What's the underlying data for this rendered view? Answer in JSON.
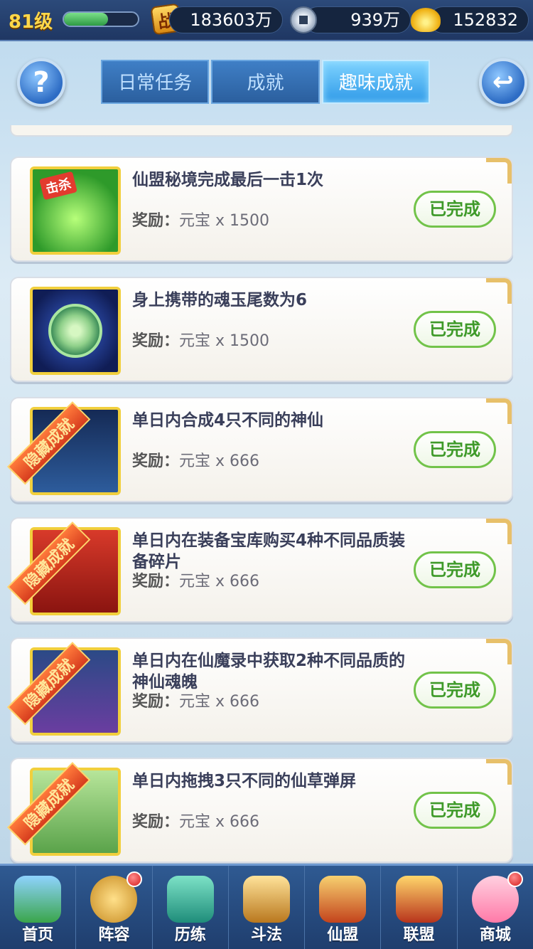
{
  "status": {
    "level": "81级",
    "level_progress": 0.6,
    "battle_power": "183603万",
    "silver": "939万",
    "gold": "152832"
  },
  "header": {
    "tabs": [
      {
        "label": "日常任务",
        "active": false
      },
      {
        "label": "成就",
        "active": false
      },
      {
        "label": "趣味成就",
        "active": true
      }
    ]
  },
  "achievements": [
    {
      "title": "仙盟秘境完成最后一击1次",
      "reward_label": "奖励：",
      "reward_value": "元宝 x 1500",
      "button": "已完成",
      "hidden_tag": "",
      "thumb_tag": "击杀"
    },
    {
      "title": "身上携带的魂玉尾数为6",
      "reward_label": "奖励：",
      "reward_value": "元宝 x 1500",
      "button": "已完成",
      "hidden_tag": ""
    },
    {
      "title": "单日内合成4只不同的神仙",
      "reward_label": "奖励：",
      "reward_value": "元宝 x 666",
      "button": "已完成",
      "hidden_tag": "隐藏成就"
    },
    {
      "title": "单日内在装备宝库购买4种不同品质装备碎片",
      "reward_label": "奖励：",
      "reward_value": "元宝 x 666",
      "button": "已完成",
      "hidden_tag": "隐藏成就"
    },
    {
      "title": "单日内在仙魔录中获取2种不同品质的神仙魂魄",
      "reward_label": "奖励：",
      "reward_value": "元宝 x 666",
      "button": "已完成",
      "hidden_tag": "隐藏成就"
    },
    {
      "title": "单日内拖拽3只不同的仙草弹屏",
      "reward_label": "奖励：",
      "reward_value": "元宝 x 666",
      "button": "已完成",
      "hidden_tag": "隐藏成就"
    }
  ],
  "bottom_nav": [
    {
      "label": "首页",
      "badge": false
    },
    {
      "label": "阵容",
      "badge": true
    },
    {
      "label": "历练",
      "badge": false
    },
    {
      "label": "斗法",
      "badge": false
    },
    {
      "label": "仙盟",
      "badge": false
    },
    {
      "label": "联盟",
      "badge": false
    },
    {
      "label": "商城",
      "badge": true
    }
  ],
  "icons": {
    "battle": "战",
    "help": "?",
    "back": "↩"
  }
}
